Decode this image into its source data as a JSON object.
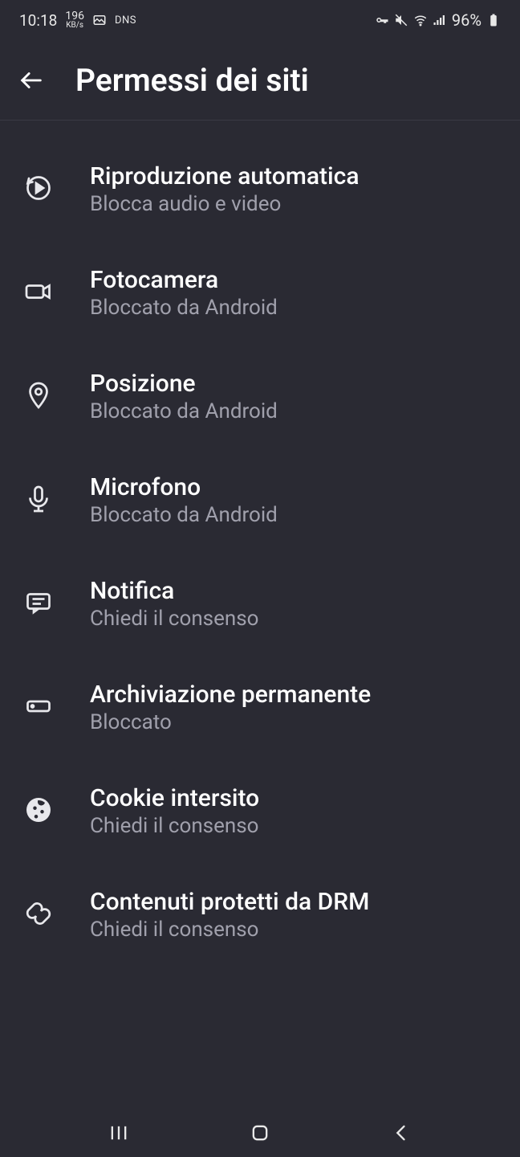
{
  "status": {
    "time": "10:18",
    "speed_value": "196",
    "speed_unit": "KB/s",
    "dns": "DNS",
    "battery": "96%"
  },
  "header": {
    "title": "Permessi dei siti"
  },
  "permissions": [
    {
      "icon": "autoplay",
      "title": "Riproduzione automatica",
      "sub": "Blocca audio e video"
    },
    {
      "icon": "camera",
      "title": "Fotocamera",
      "sub": "Bloccato da Android"
    },
    {
      "icon": "location",
      "title": "Posizione",
      "sub": "Bloccato da Android"
    },
    {
      "icon": "microphone",
      "title": "Microfono",
      "sub": "Bloccato da Android"
    },
    {
      "icon": "notification",
      "title": "Notifica",
      "sub": "Chiedi il consenso"
    },
    {
      "icon": "storage",
      "title": "Archiviazione permanente",
      "sub": "Bloccato"
    },
    {
      "icon": "cookie",
      "title": "Cookie intersito",
      "sub": "Chiedi il consenso"
    },
    {
      "icon": "drm",
      "title": "Contenuti protetti da DRM",
      "sub": "Chiedi il consenso"
    }
  ]
}
